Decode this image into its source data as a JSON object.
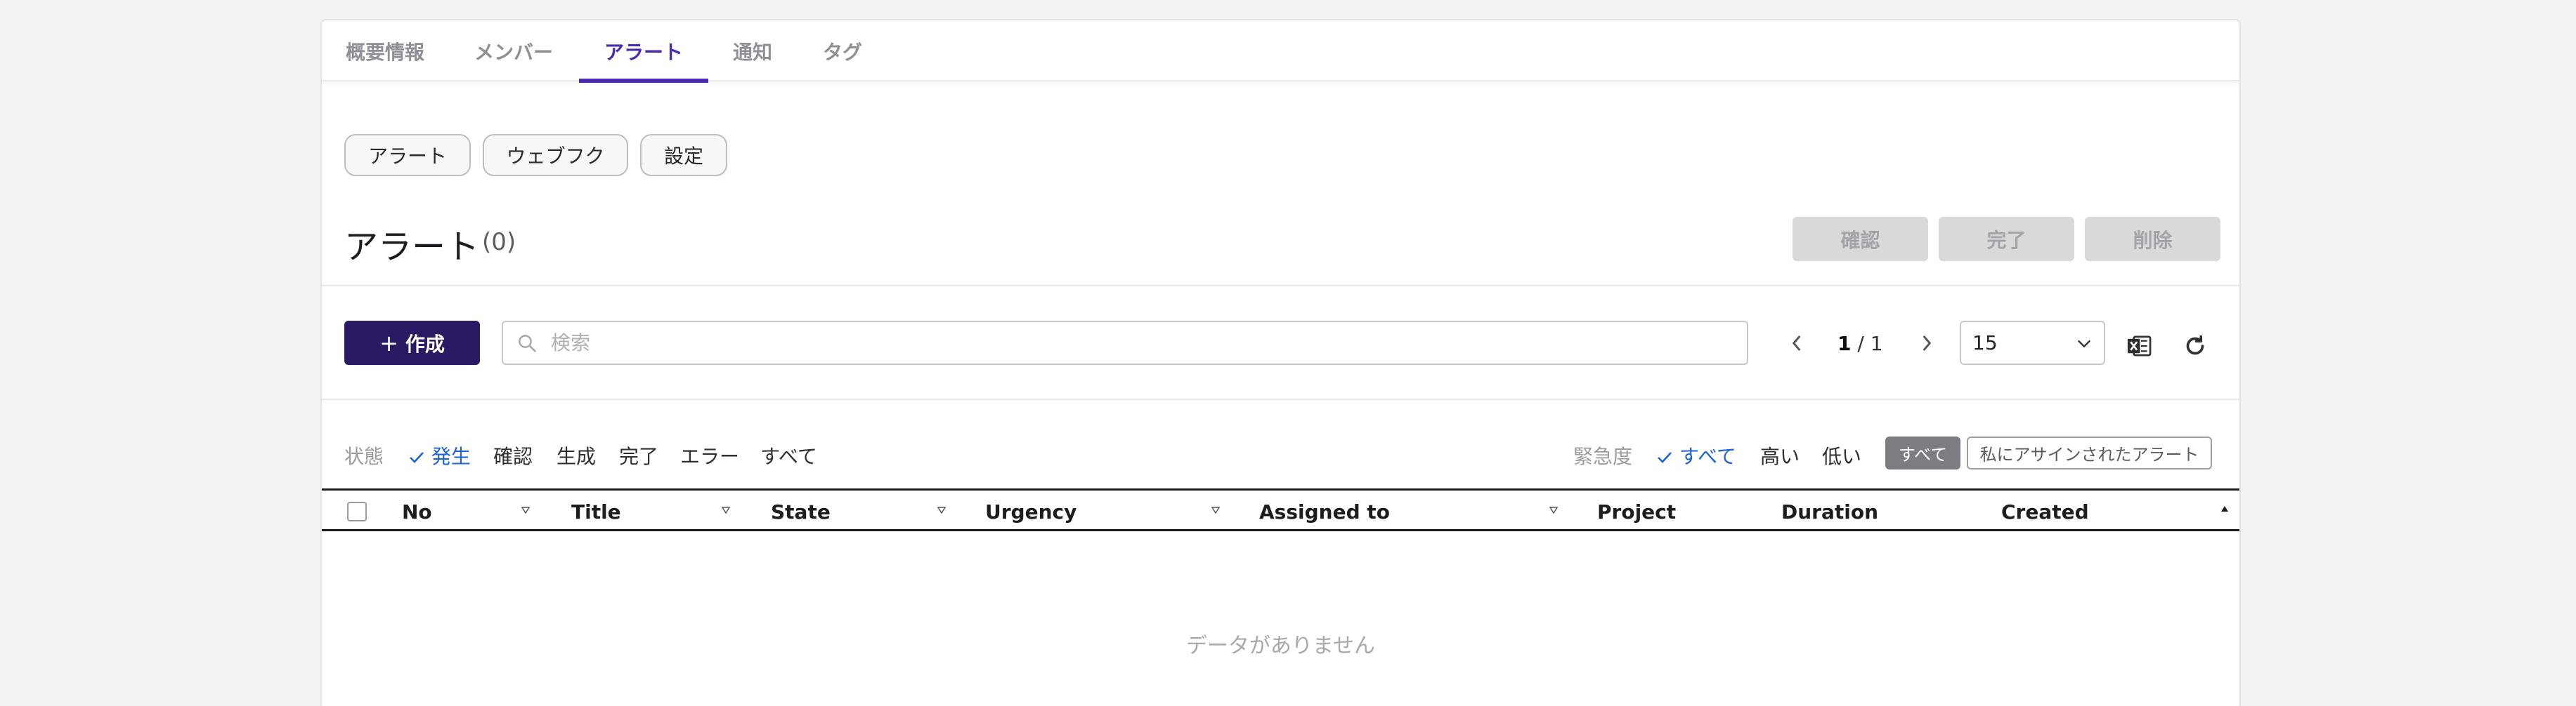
{
  "tabs": [
    {
      "label": "概要情報"
    },
    {
      "label": "メンバー"
    },
    {
      "label": "アラート"
    },
    {
      "label": "通知"
    },
    {
      "label": "タグ"
    }
  ],
  "subtabs": [
    {
      "label": "アラート"
    },
    {
      "label": "ウェブフク"
    },
    {
      "label": "設定"
    }
  ],
  "header": {
    "title": "アラート",
    "count": "(0)",
    "confirm_label": "確認",
    "complete_label": "完了",
    "delete_label": "削除"
  },
  "toolbar": {
    "create_label": "作成",
    "search_placeholder": "検索",
    "page_current": "1",
    "page_total": "/ 1",
    "page_size": "15"
  },
  "filters": {
    "state_label": "状態",
    "state_options": [
      "発生",
      "確認",
      "生成",
      "完了",
      "エラー",
      "すべて"
    ],
    "state_selected": "発生",
    "urgency_label": "緊急度",
    "urgency_options": [
      "すべて",
      "高い",
      "低い"
    ],
    "urgency_selected": "すべて",
    "assign_all": "すべて",
    "assign_mine": "私にアサインされたアラート"
  },
  "table": {
    "columns": [
      "No",
      "Title",
      "State",
      "Urgency",
      "Assigned to",
      "Project",
      "Duration",
      "Created"
    ],
    "rows": [],
    "empty_text": "データがありません"
  },
  "colors": {
    "accent": "#4a2bb0",
    "primary_button": "#2a1a63",
    "selected_filter": "#1e63d6",
    "disabled_button": "#d9d9dc"
  },
  "icons": {
    "search": "search-icon",
    "prev": "chevron-left-icon",
    "next": "chevron-right-icon",
    "dropdown": "chevron-down-icon",
    "excel": "excel-icon",
    "refresh": "refresh-icon",
    "check": "check-icon",
    "sort": "sort-icon"
  }
}
